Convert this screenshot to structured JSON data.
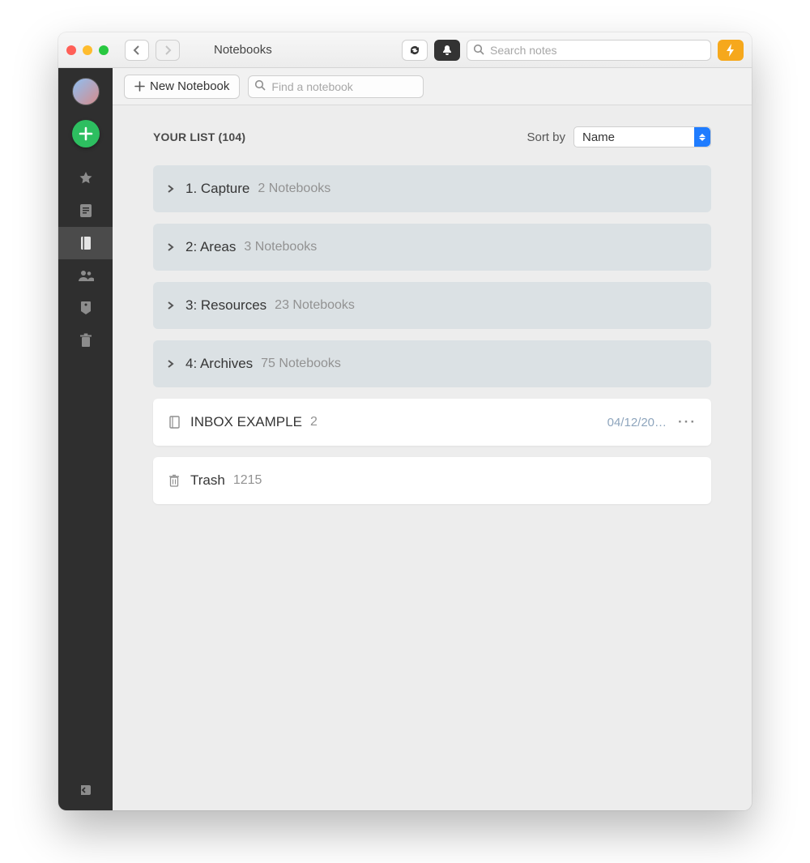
{
  "window": {
    "title": "Notebooks"
  },
  "search": {
    "global_placeholder": "Search notes",
    "find_notebook_placeholder": "Find a notebook"
  },
  "subheader": {
    "new_notebook_label": "New Notebook"
  },
  "list_header": {
    "title": "YOUR LIST (104)",
    "sort_by_label": "Sort by",
    "sort_value": "Name"
  },
  "stacks": [
    {
      "name": "1. Capture",
      "meta": "2 Notebooks"
    },
    {
      "name": "2: Areas",
      "meta": "3 Notebooks"
    },
    {
      "name": "3: Resources",
      "meta": "23 Notebooks"
    },
    {
      "name": "4: Archives",
      "meta": "75 Notebooks"
    }
  ],
  "notebooks": [
    {
      "name": "INBOX EXAMPLE",
      "count": "2",
      "date": "04/12/20…"
    }
  ],
  "trash": {
    "name": "Trash",
    "count": "1215"
  },
  "sidebar": {
    "icons": [
      "star",
      "note",
      "notebook",
      "shared",
      "tag",
      "trash"
    ],
    "active_index": 2
  },
  "colors": {
    "accent_green": "#2dbe60",
    "accent_orange": "#f6a81c",
    "select_blue": "#1f7cff"
  }
}
